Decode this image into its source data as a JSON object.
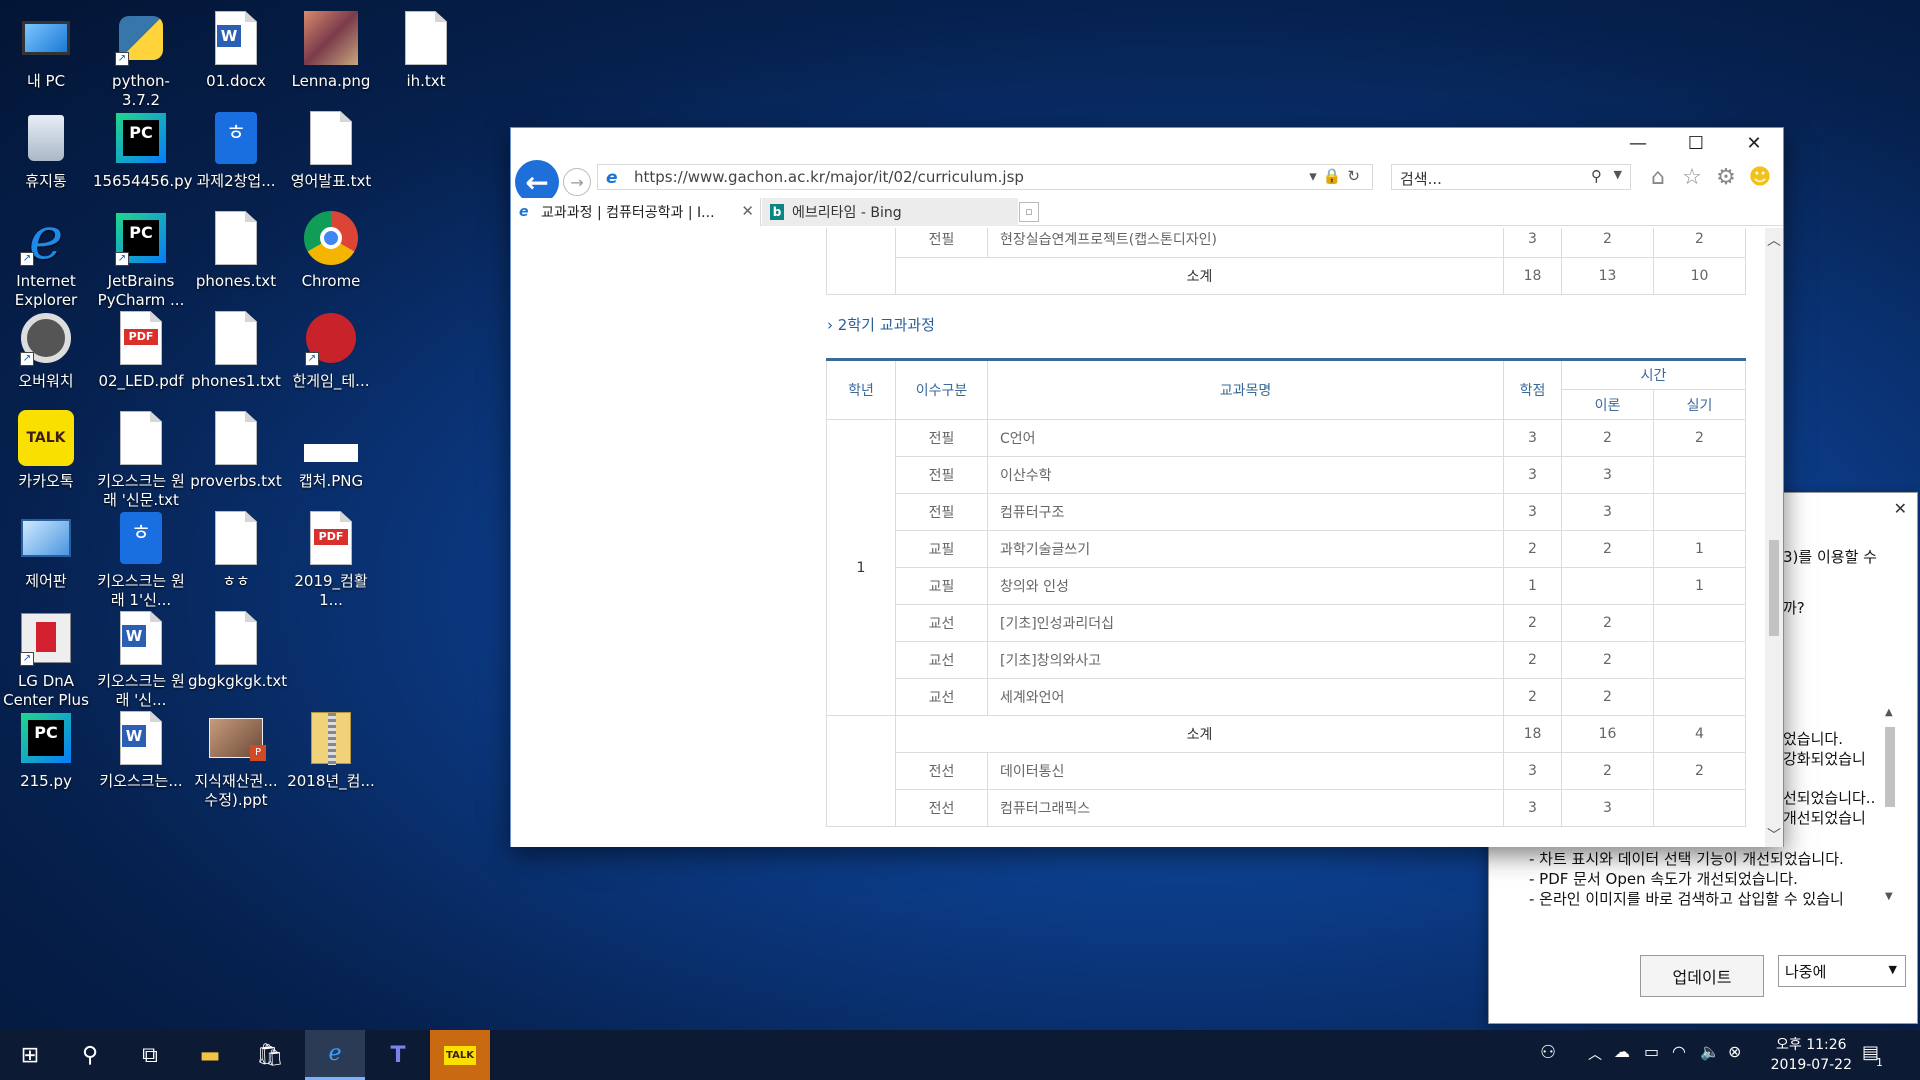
{
  "desktop": {
    "icons": [
      {
        "label": "내 PC"
      },
      {
        "label": "python-3.7.2"
      },
      {
        "label": "01.docx"
      },
      {
        "label": "Lenna.png"
      },
      {
        "label": "ih.txt"
      },
      {
        "label": "휴지통"
      },
      {
        "label": "15654456.py"
      },
      {
        "label": "과제2창업..."
      },
      {
        "label": "영어발표.txt"
      },
      {
        "label": "Internet Explorer"
      },
      {
        "label": "JetBrains PyCharm ..."
      },
      {
        "label": "phones.txt"
      },
      {
        "label": "Chrome"
      },
      {
        "label": "오버워치"
      },
      {
        "label": "02_LED.pdf"
      },
      {
        "label": "phones1.txt"
      },
      {
        "label": "한게임_테..."
      },
      {
        "label": "카카오톡"
      },
      {
        "label": "키오스크는 원래 '신문.txt"
      },
      {
        "label": "proverbs.txt"
      },
      {
        "label": "캡처.PNG"
      },
      {
        "label": "제어판"
      },
      {
        "label": "키오스크는 원래 1'신..."
      },
      {
        "label": "ㅎㅎ"
      },
      {
        "label": "2019_컴활1..."
      },
      {
        "label": "LG DnA Center Plus"
      },
      {
        "label": "키오스크는 원래 '신..."
      },
      {
        "label": "gbgkgkgk.txt"
      },
      {
        "label": "215.py"
      },
      {
        "label": "키오스크는..."
      },
      {
        "label": "지식재산권... 수정).ppt"
      },
      {
        "label": "2018년_컴..."
      }
    ]
  },
  "browser": {
    "url": "https://www.gachon.ac.kr/major/it/02/curriculum.jsp",
    "search_placeholder": "검색...",
    "tabs": [
      {
        "label": "교과과정 | 컴퓨터공학과 | I..."
      },
      {
        "label": "에브리타임 - Bing"
      }
    ],
    "prev_table": {
      "row": {
        "type": "전필",
        "subject": "현장실습연계프로젝트(캡스톤디자인)",
        "credit": "3",
        "theory": "2",
        "practice": "2"
      },
      "subtotal": {
        "label": "소계",
        "credit": "18",
        "theory": "13",
        "practice": "10"
      }
    },
    "section_title": "2학기 교과과정",
    "headers": {
      "year": "학년",
      "type": "이수구분",
      "subject": "교과목명",
      "credit": "학점",
      "time": "시간",
      "theory": "이론",
      "practice": "실기"
    },
    "year1": "1",
    "rows": [
      {
        "type": "전필",
        "subject": "C언어",
        "credit": "3",
        "theory": "2",
        "practice": "2"
      },
      {
        "type": "전필",
        "subject": "이산수학",
        "credit": "3",
        "theory": "3",
        "practice": ""
      },
      {
        "type": "전필",
        "subject": "컴퓨터구조",
        "credit": "3",
        "theory": "3",
        "practice": ""
      },
      {
        "type": "교필",
        "subject": "과학기술글쓰기",
        "credit": "2",
        "theory": "2",
        "practice": "1"
      },
      {
        "type": "교필",
        "subject": "창의와 인성",
        "credit": "1",
        "theory": "",
        "practice": "1"
      },
      {
        "type": "교선",
        "subject": "[기초]인성과리더십",
        "credit": "2",
        "theory": "2",
        "practice": ""
      },
      {
        "type": "교선",
        "subject": "[기초]창의와사고",
        "credit": "2",
        "theory": "2",
        "practice": ""
      },
      {
        "type": "교선",
        "subject": "세계와언어",
        "credit": "2",
        "theory": "2",
        "practice": ""
      }
    ],
    "subtotal": {
      "label": "소계",
      "credit": "18",
      "theory": "16",
      "practice": "4"
    },
    "year2_rows": [
      {
        "type": "전선",
        "subject": "데이터통신",
        "credit": "3",
        "theory": "2",
        "practice": "2"
      },
      {
        "type": "전선",
        "subject": "컴퓨터그래픽스",
        "credit": "3",
        "theory": "3",
        "practice": ""
      }
    ]
  },
  "popup": {
    "lines_top": [
      "3)를 이용할 수",
      "까?"
    ],
    "lines_mid": [
      "었습니다.",
      "강화되었습니",
      "선되었습니다..",
      "개선되었습니"
    ],
    "lines_bottom": [
      "- 차트 표시와 데이터 선택 기능이 개선되었습니다.",
      "- PDF 문서 Open 속도가 개선되었습니다.",
      "- 온라인 이미지를 바로 검색하고 삽입할 수 있습니"
    ],
    "update_button": "업데이트",
    "later_select": "나중에"
  },
  "taskbar": {
    "time": "오후 11:26",
    "date": "2019-07-22",
    "notification_count": "1"
  }
}
